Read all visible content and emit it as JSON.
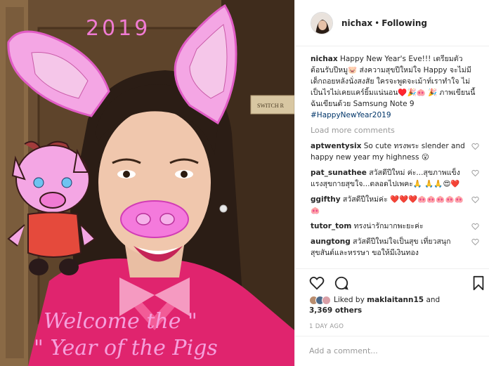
{
  "photo": {
    "drawn_year": "2019",
    "switch_sign": "SWITCH R",
    "welcome_line1": "Welcome the \"",
    "welcome_line2": "\" Year of the Pigs"
  },
  "header": {
    "username": "nichax",
    "separator": "•",
    "follow_status": "Following"
  },
  "caption": {
    "username": "nichax",
    "text": " Happy New Year's Eve!!! เตรียมตัวต้อนรับปีหมู🐷 ส่งความสุขปีใหม่ใจ Happy จะไม่มีเด็กถอยหลังนั่งสงสัย ใครจะพูดจะเม้าท์เราทำใจ ไม่เป็นไรไม่เคยแคร์ยิ้มแน่นอน♥️🎉🐽 🎉 ภาพเขียนนี้ฉันเขียนด้วย Samsung Note 9 ",
    "hashtag": "#HappyNewYear2019"
  },
  "load_more": "Load more comments",
  "comments": [
    {
      "username": "aptwentysix",
      "text": " So cute ทรงพระ slender and happy new year my highness 😮"
    },
    {
      "username": "pat_sunathee",
      "text": " สวัสดีปีใหม่ ค่ะ...สุขภาพแข็งแรงสุขกายสุขใจ...ตลอดไปเพคะ🙏 🙏🙏😍❤️"
    },
    {
      "username": "ggifthy",
      "text": " สวัสดีปีใหม่ค่ะ ❤️❤️❤️🐽🐽🐽🐽🐽🐽"
    },
    {
      "username": "tutor_tom",
      "text": " ทรงน่ารักมากพะยะค่ะ"
    },
    {
      "username": "aungtong",
      "text": " สวัสดีปีใหม่ใจเป็นสุข เที่ยวสนุกสุขสันต์และหรรษา ขอให้มีเงินทอง"
    }
  ],
  "likes": {
    "prefix": "Liked by ",
    "user": "maklaitann15",
    "middle": " and",
    "count": "3,369 others"
  },
  "timestamp": "1 DAY AGO",
  "add_comment_placeholder": "Add a comment...",
  "colors": {
    "link": "#003569",
    "muted": "#999999",
    "pink": "#f07bd3",
    "pig_fill": "#f4a6e4"
  },
  "icons": [
    "heart-icon",
    "comment-icon",
    "bookmark-icon"
  ]
}
